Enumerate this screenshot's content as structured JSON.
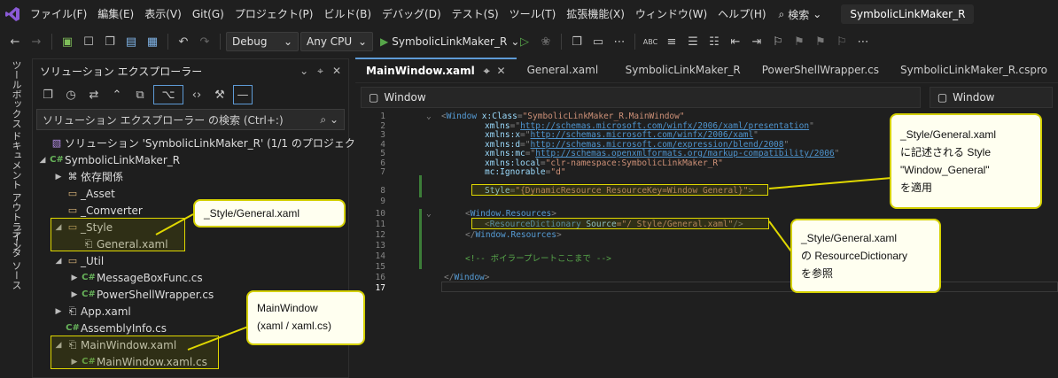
{
  "menubar": {
    "items": [
      "ファイル(F)",
      "編集(E)",
      "表示(V)",
      "Git(G)",
      "プロジェクト(P)",
      "ビルド(B)",
      "デバッグ(D)",
      "テスト(S)",
      "ツール(T)",
      "拡張機能(X)",
      "ウィンドウ(W)",
      "ヘルプ(H)"
    ],
    "search_label": "検索",
    "solution_title": "SymbolicLinkMaker_R"
  },
  "toolbar": {
    "config": "Debug",
    "platform": "Any CPU",
    "run_target": "SymbolicLinkMaker_R"
  },
  "side_tabs": [
    "ツールボックス",
    "ドキュメント アウトライン",
    "データ ソース"
  ],
  "solution_explorer": {
    "title": "ソリューション エクスプローラー",
    "search_placeholder": "ソリューション エクスプローラー の検索 (Ctrl+:)",
    "tree": [
      {
        "label": "ソリューション 'SymbolicLinkMaker_R' (1/1 のプロジェクト)",
        "icon": "solution-icon"
      },
      {
        "label": "SymbolicLinkMaker_R",
        "icon": "csharp-project-icon"
      },
      {
        "label": "依存関係",
        "icon": "dependencies-icon"
      },
      {
        "label": "_Asset",
        "icon": "folder-icon"
      },
      {
        "label": "_Comverter",
        "icon": "folder-icon"
      },
      {
        "label": "_Style",
        "icon": "folder-icon"
      },
      {
        "label": "General.xaml",
        "icon": "xaml-file-icon"
      },
      {
        "label": "_Util",
        "icon": "folder-icon"
      },
      {
        "label": "MessageBoxFunc.cs",
        "icon": "csharp-file-icon"
      },
      {
        "label": "PowerShellWrapper.cs",
        "icon": "csharp-file-icon"
      },
      {
        "label": "App.xaml",
        "icon": "xaml-file-icon"
      },
      {
        "label": "AssemblyInfo.cs",
        "icon": "csharp-file-icon"
      },
      {
        "label": "MainWindow.xaml",
        "icon": "xaml-file-icon"
      },
      {
        "label": "MainWindow.xaml.cs",
        "icon": "csharp-file-icon"
      }
    ]
  },
  "editor": {
    "tabs": [
      "MainWindow.xaml",
      "General.xaml",
      "SymbolicLinkMaker_R",
      "PowerShellWrapper.cs",
      "SymbolicLinkMaker_R.cspro"
    ],
    "nav_left": "Window",
    "nav_right": "Window",
    "line_numbers": [
      "1",
      "2",
      "3",
      "4",
      "5",
      "6",
      "7",
      "8",
      "9",
      "10",
      "11",
      "12",
      "13",
      "14",
      "15",
      "16",
      "17"
    ]
  },
  "code": {
    "l1a": "<",
    "l1b": "Window",
    "l1c": " x:Class",
    "l1d": "=",
    "l1e": "\"SymbolicLinkMaker_R.MainWindow\"",
    "l2a": "xmlns",
    "l2b": "=\"",
    "l2c": "http://schemas.microsoft.com/winfx/2006/xaml/presentation",
    "l2d": "\"",
    "l3a": "xmlns:x",
    "l3c": "http://schemas.microsoft.com/winfx/2006/xaml",
    "l4a": "xmlns:d",
    "l4c": "http://schemas.microsoft.com/expression/blend/2008",
    "l5a": "xmlns:mc",
    "l5c": "http://schemas.openxmlformats.org/markup-compatibility/2006",
    "l6a": "xmlns:local",
    "l6c": "\"clr-namespace:SymbolicLinkMaker_R\"",
    "l7a": "mc:Ignorable",
    "l7c": "\"d\"",
    "l8a": "Style",
    "l8c": "\"{DynamicResource ResourceKey=Window_General}\"",
    "l8d": ">",
    "l10a": "<",
    "l10b": "Window.Resources",
    "l10c": ">",
    "l11a": "<",
    "l11b": "ResourceDictionary",
    "l11c": " Source",
    "l11d": "=\"/_Style/General.xaml\"",
    "l11e": "/>",
    "l12a": "</",
    "l12b": "Window.Resources",
    "l12c": ">",
    "l14": "<!-- ボイラープレートここまで -->",
    "l16a": "</",
    "l16b": "Window",
    "l16c": ">"
  },
  "callouts": {
    "style_folder": "_Style/General.xaml",
    "mainwindow_1": "MainWindow",
    "mainwindow_2": "(xaml / xaml.cs)",
    "style_line1": "_Style/General.xaml",
    "style_line2": "に記述される Style",
    "style_line3": "\"Window_General\"",
    "style_line4": "を適用",
    "rd_line1": "_Style/General.xaml",
    "rd_line2": "の ResourceDictionary",
    "rd_line3": "を参照"
  }
}
